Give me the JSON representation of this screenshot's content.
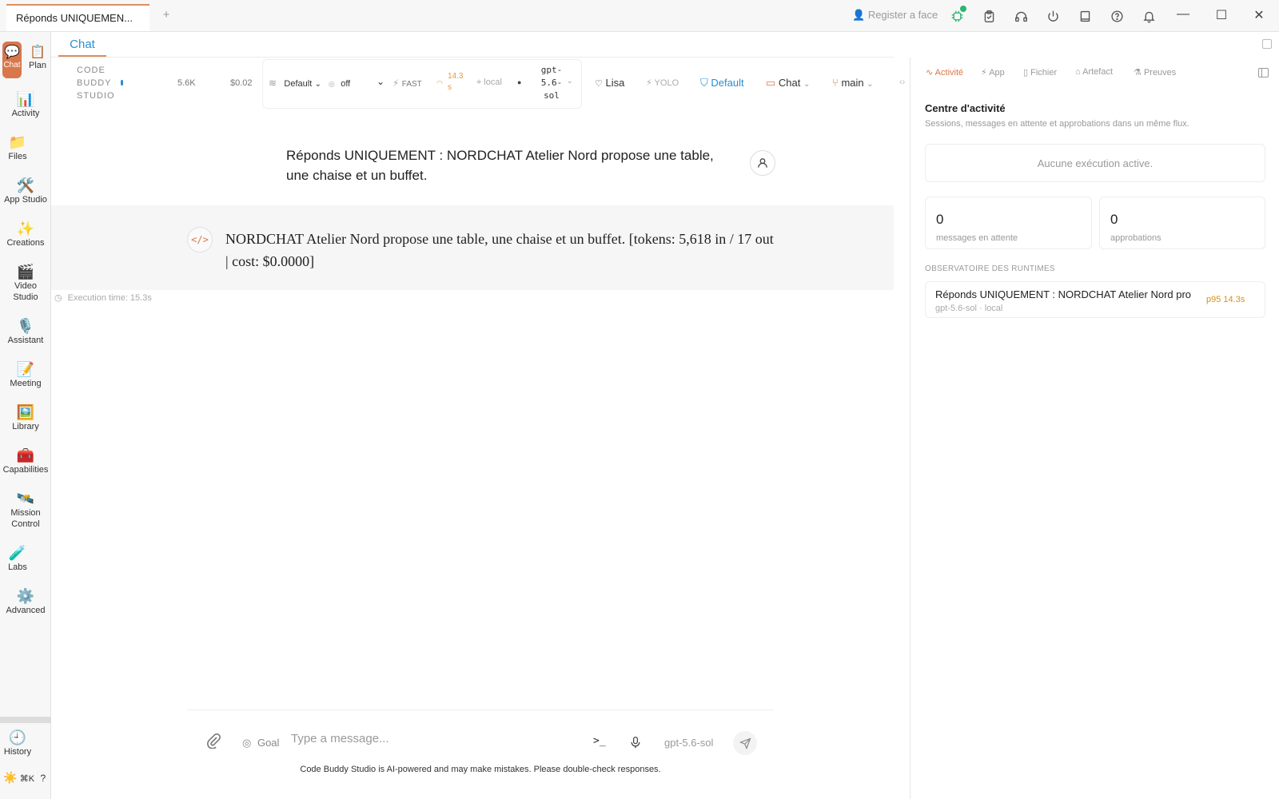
{
  "window": {
    "tab_title": "Réponds UNIQUEMEN...",
    "add_tab": "+",
    "register_face": "Register a face"
  },
  "sidebar": {
    "items": [
      {
        "label": "Chat",
        "icon": "💬"
      },
      {
        "label": "Plan",
        "icon": "📋"
      },
      {
        "label": "Activity",
        "icon": "📊"
      },
      {
        "label": "Files",
        "icon": "📁"
      },
      {
        "label": "App Studio",
        "icon": "🛠️"
      },
      {
        "label": "Creations",
        "icon": "✨"
      },
      {
        "label": "Video",
        "label2": "Studio",
        "icon": "🎬"
      },
      {
        "label": "Assistant",
        "icon": "🎙️"
      },
      {
        "label": "Meeting",
        "icon": "📝"
      },
      {
        "label": "Library",
        "icon": "🖼️"
      },
      {
        "label": "Capabilities",
        "icon": "🧰"
      },
      {
        "label": "Mission",
        "label2": "Control",
        "icon": "🛰️"
      },
      {
        "label": "Labs",
        "icon": "🧪"
      },
      {
        "label": "Advanced",
        "icon": "⚙️"
      },
      {
        "label": "History",
        "icon": "🕘"
      }
    ],
    "bottom_shortcut": "⌘K",
    "bottom_help": "?",
    "bottom_theme": "☀️"
  },
  "main": {
    "tab_label": "Chat",
    "toolbar": {
      "brand_line1": "CODE",
      "brand_line2": "BUDDY",
      "brand_line3": "STUDIO",
      "context_tokens": "5.6K",
      "cost": "$0.02",
      "profile": "Default",
      "thinking": "off",
      "speed": "FAST",
      "latency_line1": "14.3",
      "latency_line2": "s",
      "location": "local",
      "model_line1": "gpt-",
      "model_line2": "5.6-",
      "model_line3": "sol",
      "persona": "Lisa",
      "yolo": "YOLO",
      "permission": "Default",
      "mode": "Chat",
      "branch": "main"
    },
    "user_message": "Réponds UNIQUEMENT : NORDCHAT Atelier Nord propose une table, une chaise et un buffet.",
    "assistant_message": "NORDCHAT Atelier Nord propose une table, une chaise et un buffet. [tokens: 5,618 in / 17 out | cost: $0.0000]",
    "execution_time": "Execution time: 15.3s",
    "composer": {
      "goal_label": "Goal",
      "placeholder": "Type a message...",
      "model": "gpt-5.6-sol",
      "terminal_glyph": ">_",
      "disclaimer": "Code Buddy Studio is AI-powered and may make mistakes. Please double-check responses."
    }
  },
  "right_panel": {
    "tabs": [
      "Activité",
      "App",
      "Fichier",
      "Artefact",
      "Preuves"
    ],
    "title": "Centre d'activité",
    "subtitle": "Sessions, messages en attente et approbations dans un même flux.",
    "empty_state": "Aucune exécution active.",
    "stats": [
      {
        "value": "0",
        "label": "messages en attente"
      },
      {
        "value": "0",
        "label": "approbations"
      }
    ],
    "section_title": "OBSERVATOIRE DES RUNTIMES",
    "runtime": {
      "title": "Réponds UNIQUEMENT : NORDCHAT Atelier Nord prop...",
      "meta": "gpt-5.6-sol · local",
      "badge": "p95 14.3s"
    }
  },
  "colors": {
    "accent_orange": "#d9774c",
    "accent_blue": "#2a8fd0",
    "status_green": "#2bb673"
  }
}
